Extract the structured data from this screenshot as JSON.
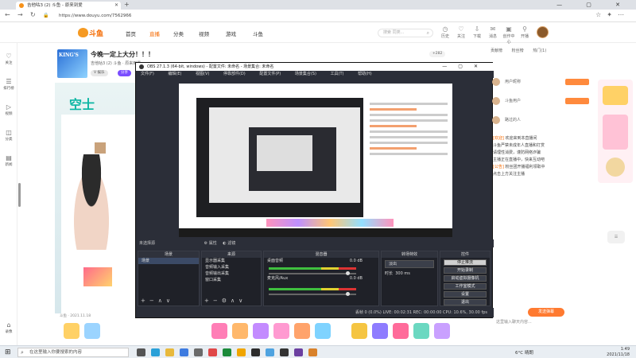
{
  "browser": {
    "tab_title": "吉他咕3 (2) 斗鱼 - 原来到爱",
    "url": "https://www.douyu.com/7562966",
    "window_controls": "— ▢ ✕"
  },
  "site": {
    "logo_text": "斗鱼",
    "nav": [
      "首页",
      "直播",
      "分类",
      "视频",
      "游戏",
      "斗鱼"
    ],
    "active_nav": 1,
    "search_placeholder": "搜索 同类...",
    "header_icons": [
      {
        "icon": "history-icon",
        "label": "历史"
      },
      {
        "icon": "follow-icon",
        "label": "关注"
      },
      {
        "icon": "download-icon",
        "label": "下载"
      },
      {
        "icon": "message-icon",
        "label": "消息"
      },
      {
        "icon": "creator-icon",
        "label": "创作中心"
      },
      {
        "icon": "live-icon",
        "label": "开播"
      }
    ]
  },
  "leftbar": [
    {
      "icon": "follow-icon",
      "label": "关注"
    },
    {
      "icon": "rank-icon",
      "label": "排行榜"
    },
    {
      "icon": "video-icon",
      "label": "视频"
    },
    {
      "icon": "category-icon",
      "label": "分类"
    },
    {
      "icon": "news-icon",
      "label": "新闻"
    },
    {
      "icon": "record-icon",
      "label": "录像"
    }
  ],
  "room": {
    "title": "今晚一定上大分！！！",
    "subtitle": "吉他咕3 (2) 斗鱼 · 原来到爱",
    "tag1": "V 娱乐",
    "tag2": "分享",
    "follow_count": "+282",
    "stream_footer": "斗鱼 · 2021.11.18",
    "big_text": "空士"
  },
  "obs": {
    "title": "OBS 27.1.3 (64-bit, windows) - 配置文件: 未命名 - 场景集合: 未命名",
    "menu": [
      "文件(F)",
      "编辑(E)",
      "视图(V)",
      "停靠部件(D)",
      "配置文件(P)",
      "场景集合(S)",
      "工具(T)",
      "帮助(H)"
    ],
    "bar_left": "未选择源",
    "bar_props": "属性",
    "bar_filters": "滤镜",
    "dock_scenes": "场景",
    "scene_item": "场景",
    "dock_sources": "来源",
    "sources": [
      "显示器采集",
      "音频输入采集",
      "音频输出采集",
      "窗口采集"
    ],
    "dock_mixer": "混音器",
    "mixer_tracks": [
      {
        "name": "桌面音频",
        "level": "0.0 dB"
      },
      {
        "name": "麦克风/Aux",
        "level": "0.0 dB"
      }
    ],
    "dock_transitions": "转场特效",
    "transition_name": "淡出",
    "duration_label": "时长",
    "duration_value": "300 ms",
    "dock_controls": "控件",
    "controls": [
      "停止推流",
      "开始录制",
      "启动虚拟摄像机",
      "工作室模式",
      "设置",
      "退出"
    ],
    "status": "丢帧 0 (0.0%)   LIVE: 00:02:31   REC: 00:00:00   CPU: 10.6%, 30.00 fps"
  },
  "rank": {
    "tabs": [
      "贡献榜",
      "粉丝榜",
      "热门(1)"
    ],
    "items": [
      "用户昵称",
      "斗鱼用户",
      "路过的人"
    ]
  },
  "chat": {
    "lines": [
      {
        "user": "[欢迎]",
        "text": "欢迎来到本直播间"
      },
      {
        "user": "",
        "text": "斗鱼严禁未成年人直播和打赏"
      },
      {
        "user": "",
        "text": "请理性消费，谨防网络诈骗"
      },
      {
        "user": "",
        "text": "主播正在直播中，快来互动吧"
      },
      {
        "user": "[公告]",
        "text": "粉丝团开播福利领取中"
      },
      {
        "user": "",
        "text": "点击上方关注主播"
      }
    ],
    "send_label": "发送弹幕",
    "input_placeholder": "这里输入聊天内容..."
  },
  "taskbar": {
    "search_placeholder": "在这里输入你要搜索的内容",
    "weather": "6°C 晴朗",
    "time": "1:49",
    "date": "2021/11/18"
  },
  "colors": {
    "accent": "#f56a00",
    "obs_bg": "#2b2e38"
  }
}
